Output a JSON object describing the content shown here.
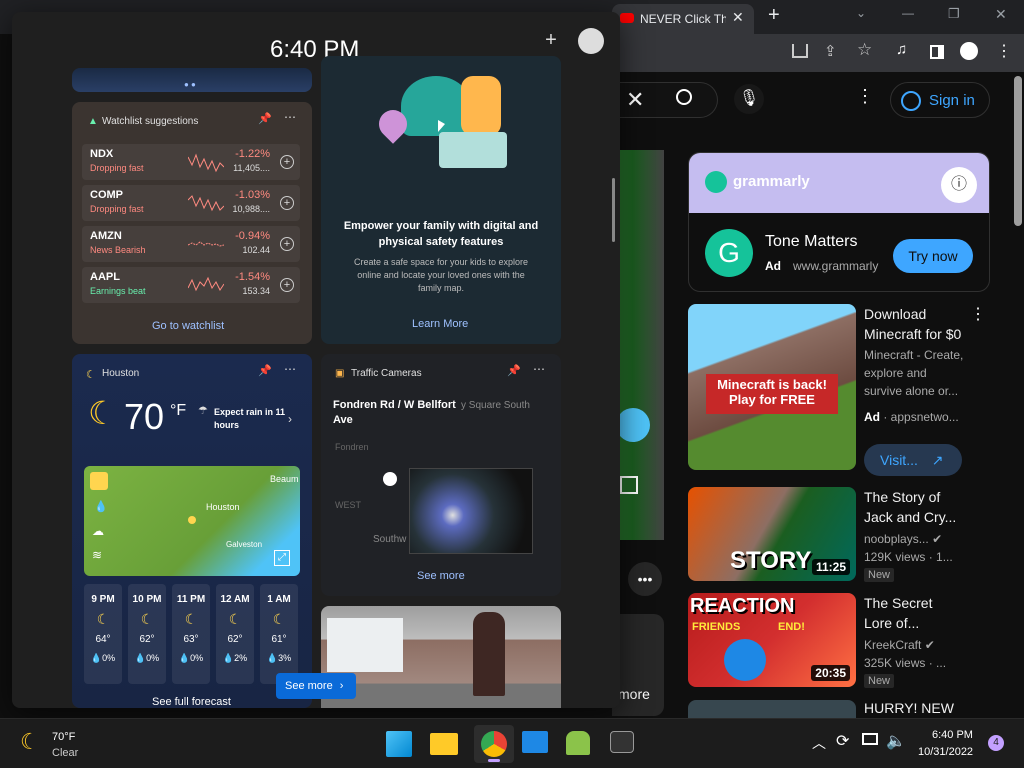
{
  "chrome": {
    "active_tab_title": "NEVER Click The",
    "new_tab_symbol": "+",
    "window_minimize": "—",
    "window_restore": "❐",
    "window_close": "✕",
    "sign_in_label": "Sign in"
  },
  "youtube": {
    "ad": {
      "banner_brand": "grammarly",
      "title": "Tone Matters",
      "ad_label": "Ad",
      "url": "www.grammarly",
      "cta": "Try now"
    },
    "videos": [
      {
        "title_line1": "Download",
        "title_line2": "Minecraft for $0",
        "desc1": "Minecraft - Create,",
        "desc2": "explore and",
        "desc3": "survive alone or...",
        "ad_label": "Ad",
        "channel": "appsnetwo...",
        "thumb_text1": "Minecraft is back!",
        "thumb_text2": "Play for FREE",
        "visit": "Visit..."
      },
      {
        "title_line1": "The Story of",
        "title_line2": "Jack and Cry...",
        "channel": "noobplays...",
        "views": "129K views · 1...",
        "badge": "New",
        "thumb_text": "STORY",
        "duration": "11:25"
      },
      {
        "title_line1": "The Secret",
        "title_line2": "Lore of...",
        "channel": "KreekCraft",
        "views": "325K views · ...",
        "badge": "New",
        "thumb_text1": "REACTION",
        "thumb_text2": "FRIENDS",
        "thumb_text3": "END!",
        "duration": "20:35"
      },
      {
        "title_line1": "HURRY! NEW"
      }
    ],
    "more_text": "more"
  },
  "widgets": {
    "clock": "6:40 PM",
    "watchlist": {
      "title": "Watchlist suggestions",
      "stocks": [
        {
          "symbol": "NDX",
          "status": "Dropping fast",
          "change": "-1.22%",
          "value": "11,405...."
        },
        {
          "symbol": "COMP",
          "status": "Dropping fast",
          "change": "-1.03%",
          "value": "10,988...."
        },
        {
          "symbol": "AMZN",
          "status": "News Bearish",
          "change": "-0.94%",
          "value": "102.44"
        },
        {
          "symbol": "AAPL",
          "status": "Earnings beat",
          "change": "-1.54%",
          "value": "153.34"
        }
      ],
      "link": "Go to watchlist",
      "status_colors": {
        "negative": "#ff8a80",
        "earnings": "#69f0ae"
      }
    },
    "family": {
      "title": "Empower your family with digital and physical safety features",
      "body": "Create a safe space for your kids to explore online and locate your loved ones with the family map.",
      "link": "Learn More"
    },
    "weather": {
      "city": "Houston",
      "temp": "70",
      "unit": "°F",
      "forecast_note": "Expect rain in 11 hours",
      "map_labels": {
        "beaumont": "Beaum",
        "houston": "Houston",
        "galveston": "Galveston"
      },
      "hours": [
        {
          "time": "9 PM",
          "temp": "64°",
          "precip": "0%"
        },
        {
          "time": "10 PM",
          "temp": "62°",
          "precip": "0%"
        },
        {
          "time": "11 PM",
          "temp": "63°",
          "precip": "0%"
        },
        {
          "time": "12 AM",
          "temp": "62°",
          "precip": "2%"
        },
        {
          "time": "1 AM",
          "temp": "61°",
          "precip": "3%"
        }
      ],
      "link": "See full forecast"
    },
    "traffic": {
      "title": "Traffic Cameras",
      "location": "Fondren Rd / W Bellfort Ave",
      "map_labels": {
        "sq": "y Square South",
        "fondren": "Fondren",
        "southwest": "Southwest",
        "west": "WEST",
        "southw": "Southw"
      },
      "link": "See more"
    },
    "see_more_button": "See more"
  },
  "taskbar": {
    "weather_temp": "70°F",
    "weather_cond": "Clear",
    "time": "6:40 PM",
    "date": "10/31/2022",
    "notification_count": "4"
  }
}
